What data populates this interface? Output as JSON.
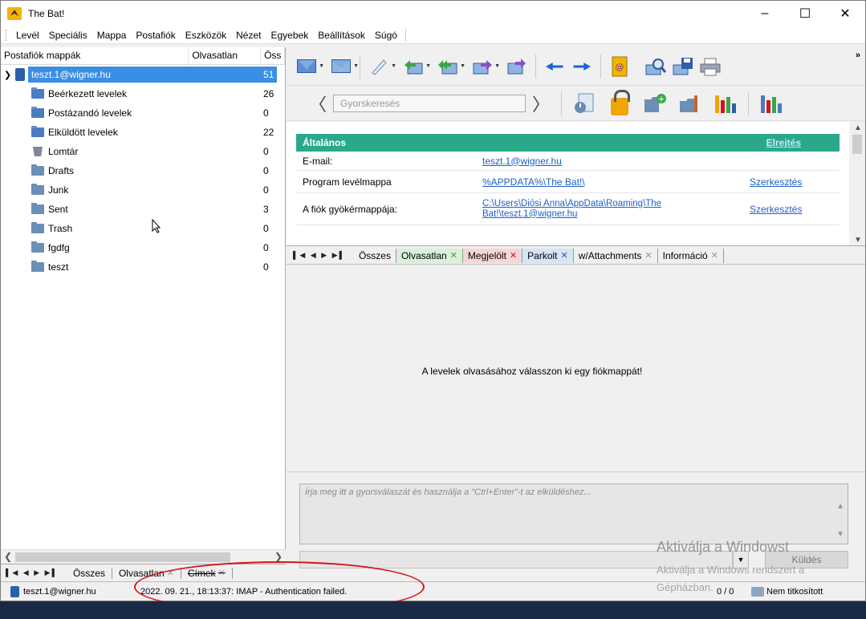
{
  "window": {
    "title": "The Bat!",
    "controls": {
      "minimize": "–",
      "maximize": "☐",
      "close": "✕"
    }
  },
  "menu": [
    "Levél",
    "Speciális",
    "Mappa",
    "Postafiók",
    "Eszközök",
    "Nézet",
    "Egyebek",
    "Beállítások",
    "Súgó"
  ],
  "folder_pane": {
    "columns": [
      "Postafiók mappák",
      "Olvasatlan",
      "Öss"
    ],
    "account": {
      "name": "teszt.1@wigner.hu",
      "count": "51"
    },
    "folders": [
      {
        "name": "Beérkezett levelek",
        "count": "26",
        "icon": "inbox-folder-icon"
      },
      {
        "name": "Postázandó levelek",
        "count": "0",
        "icon": "outbox-folder-icon"
      },
      {
        "name": "Elküldött levelek",
        "count": "22",
        "icon": "sent-folder-icon"
      },
      {
        "name": "Lomtár",
        "count": "0",
        "icon": "trash-bin-icon"
      },
      {
        "name": "Drafts",
        "count": "0",
        "icon": "folder-icon"
      },
      {
        "name": "Junk",
        "count": "0",
        "icon": "folder-icon"
      },
      {
        "name": "Sent",
        "count": "3",
        "icon": "folder-icon"
      },
      {
        "name": "Trash",
        "count": "0",
        "icon": "folder-icon"
      },
      {
        "name": "fgdfg",
        "count": "0",
        "icon": "folder-icon"
      },
      {
        "name": "teszt",
        "count": "0",
        "icon": "folder-icon"
      }
    ],
    "bottom_tabs": [
      "Összes",
      "Olvasatlan",
      "Címek"
    ]
  },
  "quicksearch": {
    "placeholder": "Gyorskeresés"
  },
  "info_panel": {
    "header": "Általános",
    "hide_link": "Elrejtés",
    "rows": [
      {
        "key": "E-mail:",
        "value": "teszt.1@wigner.hu",
        "edit": ""
      },
      {
        "key": "Program levélmappa",
        "value": "%APPDATA%\\The Bat!\\",
        "edit": "Szerkesztés"
      },
      {
        "key": "A fiók gyökérmappája:",
        "value": "C:\\Users\\Diósi Anna\\AppData\\Roaming\\The Bat!\\teszt.1@wigner.hu",
        "edit": "Szerkesztés"
      }
    ]
  },
  "filter_tabs": [
    {
      "label": "Összes",
      "closable": false,
      "color": "#f0f0f0"
    },
    {
      "label": "Olvasatlan",
      "closable": true,
      "color": "#d9f0d9"
    },
    {
      "label": "Megjelölt",
      "closable": true,
      "color": "#f5d6d6"
    },
    {
      "label": "Parkolt",
      "closable": true,
      "color": "#d6e4f5"
    },
    {
      "label": "w/Attachments",
      "closable": true,
      "color": "#f0f0f0"
    },
    {
      "label": "Információ",
      "closable": true,
      "color": "#f0f0f0"
    }
  ],
  "message_area": {
    "empty_text": "A levelek olvasásához válasszon ki egy fiókmappát!"
  },
  "quick_reply": {
    "placeholder": "Írja meg itt a gyorsválaszát és használja a \"Ctrl+Enter\"-t az elküldéshez...",
    "send_label": "Küldés"
  },
  "statusbar": {
    "account": "teszt.1@wigner.hu",
    "message": "2022. 09. 21., 18:13:37: IMAP  - Authentication failed.",
    "counter": "0 / 0",
    "encryption": "Nem titkosított"
  },
  "watermark": {
    "line1": "Aktiválja a Windowst",
    "line2": "Aktiválja a Windows rendszert a",
    "line3": "Gépházban."
  },
  "colors": {
    "selection": "#3a8ee6",
    "info_header": "#2aa88a",
    "link": "#1f5fc7",
    "annotation": "#d6141a"
  }
}
